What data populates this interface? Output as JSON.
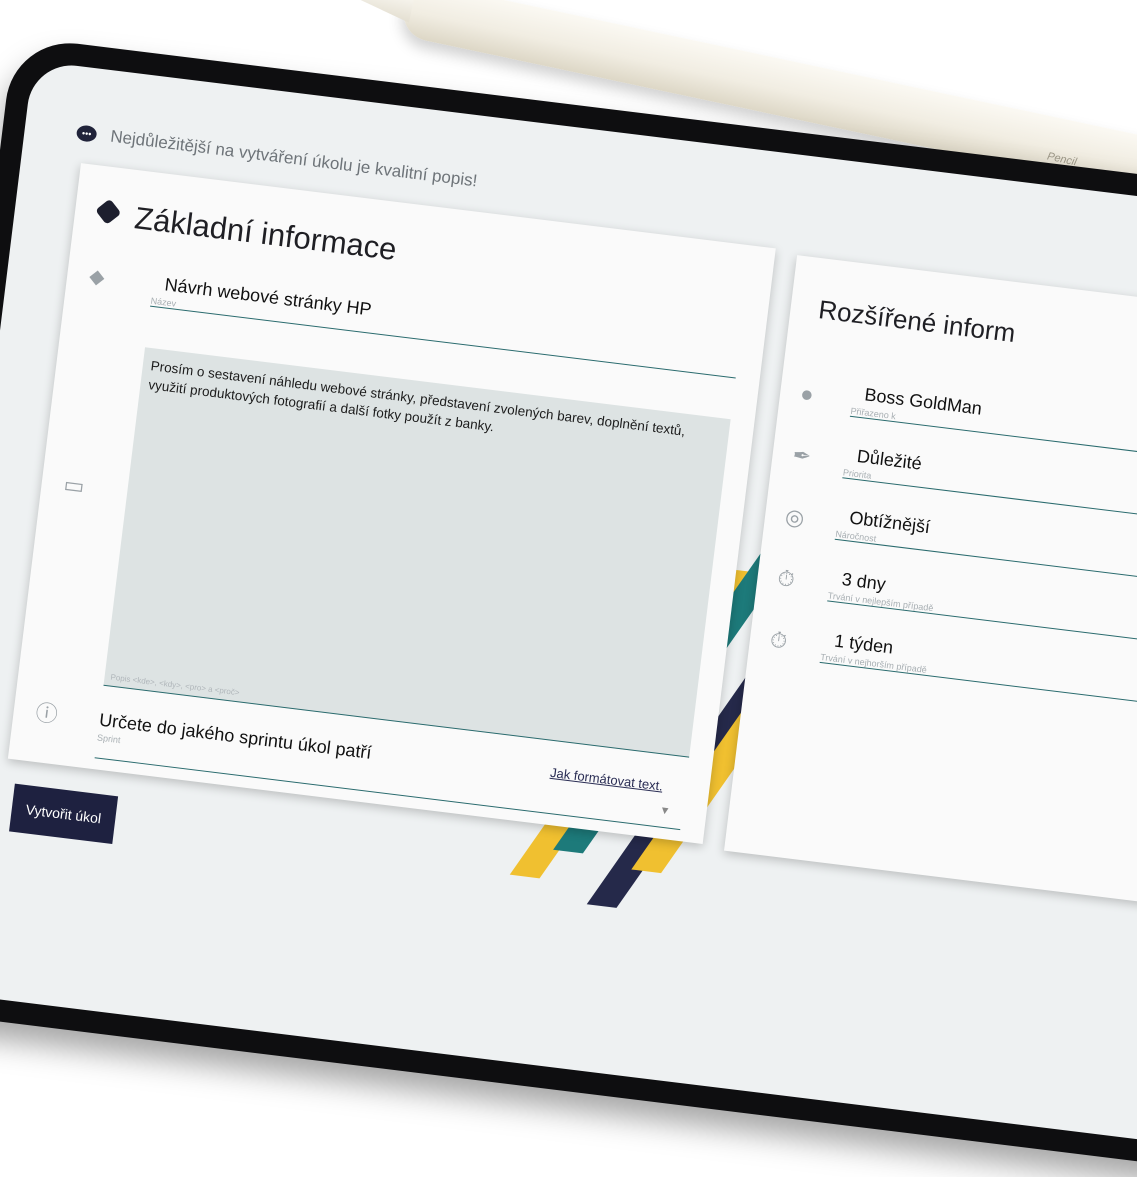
{
  "pencil": {
    "brand": "Pencil"
  },
  "hint": {
    "text": "Nejdůležitější na vytváření úkolu je kvalitní popis!"
  },
  "basic_info": {
    "title": "Základní informace",
    "name_value": "Návrh webové stránky HP",
    "name_label": "Název",
    "description_value": "Prosím o sestavení náhledu webové stránky, představení zvolených barev, doplnění textů, využití produktových fotografií a další fotky použít z banky.",
    "description_label": "Popis <kde>, <kdy>, <pro> a <proč>",
    "format_link": "Jak formátovat text.",
    "sprint_value": "Určete do jakého sprintu úkol patří",
    "sprint_label": "Sprint"
  },
  "create_button": "Vytvořit úkol",
  "extended_info": {
    "title": "Rozšířené inform",
    "fields": [
      {
        "value": "Boss GoldMan",
        "label": "Přiřazeno k",
        "icon": "user-icon"
      },
      {
        "value": "Důležité",
        "label": "Priorita",
        "icon": "feather-icon"
      },
      {
        "value": "Obtížnější",
        "label": "Náročnost",
        "icon": "gauge-icon"
      },
      {
        "value": "3 dny",
        "label": "Trvání v nejlepším případě",
        "icon": "stopwatch-icon"
      },
      {
        "value": "1 týden",
        "label": "Trvání v nejhorším případě",
        "icon": "stopwatch-icon"
      }
    ]
  },
  "colors": {
    "dark": "#1e2140",
    "accent": "#2a6b6e",
    "yellow": "#f0c030",
    "teal": "#1d7a7a"
  }
}
